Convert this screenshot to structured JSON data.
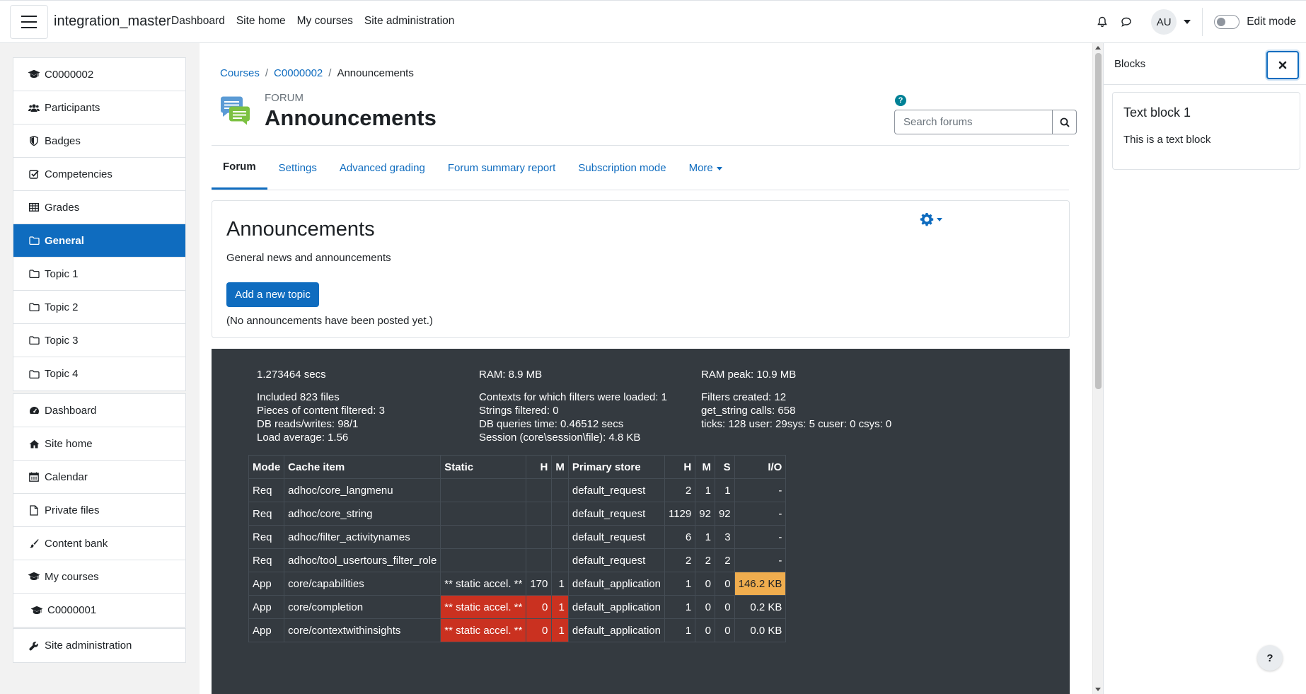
{
  "navbar": {
    "brand": "integration_master",
    "links": [
      "Dashboard",
      "Site home",
      "My courses",
      "Site administration"
    ],
    "user_initials": "AU",
    "edit_mode_label": "Edit mode",
    "icons": [
      "hamburger-icon",
      "bell-icon",
      "chat-icon",
      "chevron-down-icon"
    ]
  },
  "course_nav": {
    "items": [
      {
        "label": "C0000002",
        "icon": "graduation-cap-icon"
      },
      {
        "label": "Participants",
        "icon": "users-icon"
      },
      {
        "label": "Badges",
        "icon": "shield-icon"
      },
      {
        "label": "Competencies",
        "icon": "check-square-icon"
      },
      {
        "label": "Grades",
        "icon": "table-icon"
      },
      {
        "label": "General",
        "icon": "folder-icon",
        "active": true
      },
      {
        "label": "Topic 1",
        "icon": "folder-icon"
      },
      {
        "label": "Topic 2",
        "icon": "folder-icon"
      },
      {
        "label": "Topic 3",
        "icon": "folder-icon"
      },
      {
        "label": "Topic 4",
        "icon": "folder-icon"
      }
    ]
  },
  "site_nav": {
    "items": [
      {
        "label": "Dashboard",
        "icon": "dashboard-icon"
      },
      {
        "label": "Site home",
        "icon": "home-icon"
      },
      {
        "label": "Calendar",
        "icon": "calendar-icon"
      },
      {
        "label": "Private files",
        "icon": "file-icon"
      },
      {
        "label": "Content bank",
        "icon": "brush-icon"
      },
      {
        "label": "My courses",
        "icon": "graduation-cap-icon"
      },
      {
        "label": "C0000001",
        "icon": "graduation-cap-icon"
      }
    ]
  },
  "admin_nav": {
    "label": "Site administration",
    "icon": "wrench-icon"
  },
  "breadcrumb": [
    "Courses",
    "C0000002",
    "Announcements"
  ],
  "header": {
    "subtitle": "FORUM",
    "title": "Announcements",
    "search_placeholder": "Search forums"
  },
  "tabs": [
    "Forum",
    "Settings",
    "Advanced grading",
    "Forum summary report",
    "Subscription mode",
    "More"
  ],
  "forum_card": {
    "title": "Announcements",
    "description": "General news and announcements",
    "add_button": "Add a new topic",
    "empty_text": "(No announcements have been posted yet.)"
  },
  "perf": {
    "col1": [
      "1.273464 secs",
      "Included 823 files",
      "Pieces of content filtered: 3",
      "DB reads/writes: 98/1",
      "Load average: 1.56"
    ],
    "col2": [
      "RAM: 8.9 MB",
      "Contexts for which filters were loaded: 1",
      "Strings filtered: 0",
      "DB queries time: 0.46512 secs",
      "Session (core\\session\\file): 4.8 KB"
    ],
    "col3": [
      "RAM peak: 10.9 MB",
      "Filters created: 12",
      "get_string calls: 658",
      "ticks: 128 user: 29sys: 5 cuser: 0 csys: 0"
    ],
    "table_headers": [
      "Mode",
      "Cache item",
      "Static",
      "H",
      "M",
      "Primary store",
      "H",
      "M",
      "S",
      "I/O"
    ],
    "rows": [
      [
        "Req",
        "adhoc/core_langmenu",
        "",
        "",
        "",
        "default_request",
        "2",
        "1",
        "1",
        "-"
      ],
      [
        "Req",
        "adhoc/core_string",
        "",
        "",
        "",
        "default_request",
        "1129",
        "92",
        "92",
        "-"
      ],
      [
        "Req",
        "adhoc/filter_activitynames",
        "",
        "",
        "",
        "default_request",
        "6",
        "1",
        "3",
        "-"
      ],
      [
        "Req",
        "adhoc/tool_usertours_filter_role",
        "",
        "",
        "",
        "default_request",
        "2",
        "2",
        "2",
        "-"
      ],
      [
        "App",
        "core/capabilities",
        "** static accel. **",
        "170",
        "1",
        "default_application",
        "1",
        "0",
        "0",
        "146.2 KB"
      ],
      [
        "App",
        "core/completion",
        "** static accel. **",
        "0",
        "1",
        "default_application",
        "1",
        "0",
        "0",
        "0.2 KB"
      ],
      [
        "App",
        "core/contextwithinsights",
        "** static accel. **",
        "0",
        "1",
        "default_application",
        "1",
        "0",
        "0",
        "0.0 KB"
      ]
    ]
  },
  "right_drawer": {
    "title": "Blocks",
    "block_title": "Text block 1",
    "block_body": "This is a text block"
  },
  "help_button": "?",
  "colors": {
    "primary": "#0f6cbf",
    "perf_bg": "#343a40",
    "danger": "#ca3120",
    "warning": "#f0ad4e"
  }
}
